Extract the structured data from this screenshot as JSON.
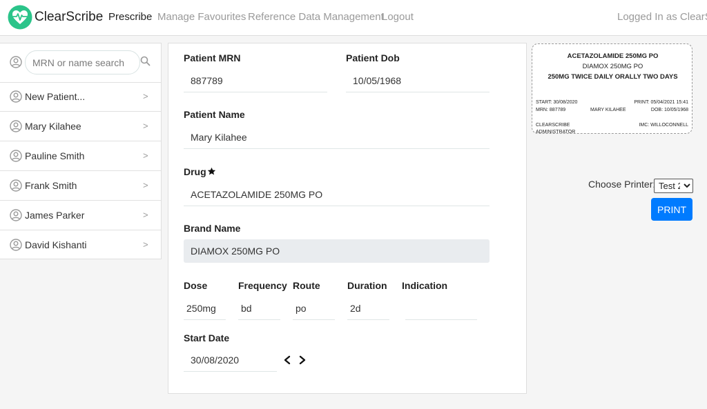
{
  "app": {
    "brand": "ClearScribe",
    "accent_color": "#2bc48a",
    "primary_color": "#007bff"
  },
  "nav": {
    "items": [
      {
        "label": "Prescribe",
        "active": true
      },
      {
        "label": "Manage Favourites",
        "active": false
      },
      {
        "label": "Reference Data Management",
        "active": false
      },
      {
        "label": "Logout",
        "active": false
      }
    ],
    "logged_in": "Logged In as ClearScribe"
  },
  "sidebar": {
    "search_placeholder": "MRN or name search",
    "patients": [
      {
        "name": "New Patient..."
      },
      {
        "name": "Mary Kilahee"
      },
      {
        "name": "Pauline Smith"
      },
      {
        "name": "Frank Smith"
      },
      {
        "name": "James Parker"
      },
      {
        "name": "David Kishanti"
      }
    ],
    "chevron": ">"
  },
  "form": {
    "mrn_label": "Patient MRN",
    "mrn_value": "887789",
    "dob_label": "Patient Dob",
    "dob_value": "10/05/1968",
    "name_label": "Patient Name",
    "name_value": "Mary Kilahee",
    "drug_label": "Drug",
    "drug_value": "ACETAZOLAMIDE 250MG PO",
    "brand_label": "Brand Name",
    "brand_value": "DIAMOX 250MG PO",
    "dose_label": "Dose",
    "dose_value": "250mg",
    "frequency_label": "Frequency",
    "frequency_value": "bd",
    "route_label": "Route",
    "route_value": "po",
    "duration_label": "Duration",
    "duration_value": "2d",
    "indication_label": "Indication",
    "indication_value": "",
    "start_date_label": "Start Date",
    "start_date_value": "30/08/2020"
  },
  "label_preview": {
    "drug": "ACETAZOLAMIDE 250MG PO",
    "brand": "DIAMOX 250MG PO",
    "directions": "250MG TWICE DAILY ORALLY TWO DAYS",
    "start": "START: 30/08/2020",
    "print": "PRINT: 05/04/2021 15:41",
    "mrn": "MRN: 887789",
    "patient": "MARY KILAHEE",
    "dob": "DOB: 10/05/1968",
    "prescriber_line1": "CLEARSCRIBE",
    "prescriber_line2": "ADMINISTRATOR",
    "imc": "IMC: WILLOCONNELL"
  },
  "printer": {
    "label": "Choose Printer:",
    "selected": "Test 2",
    "button": "PRINT"
  }
}
